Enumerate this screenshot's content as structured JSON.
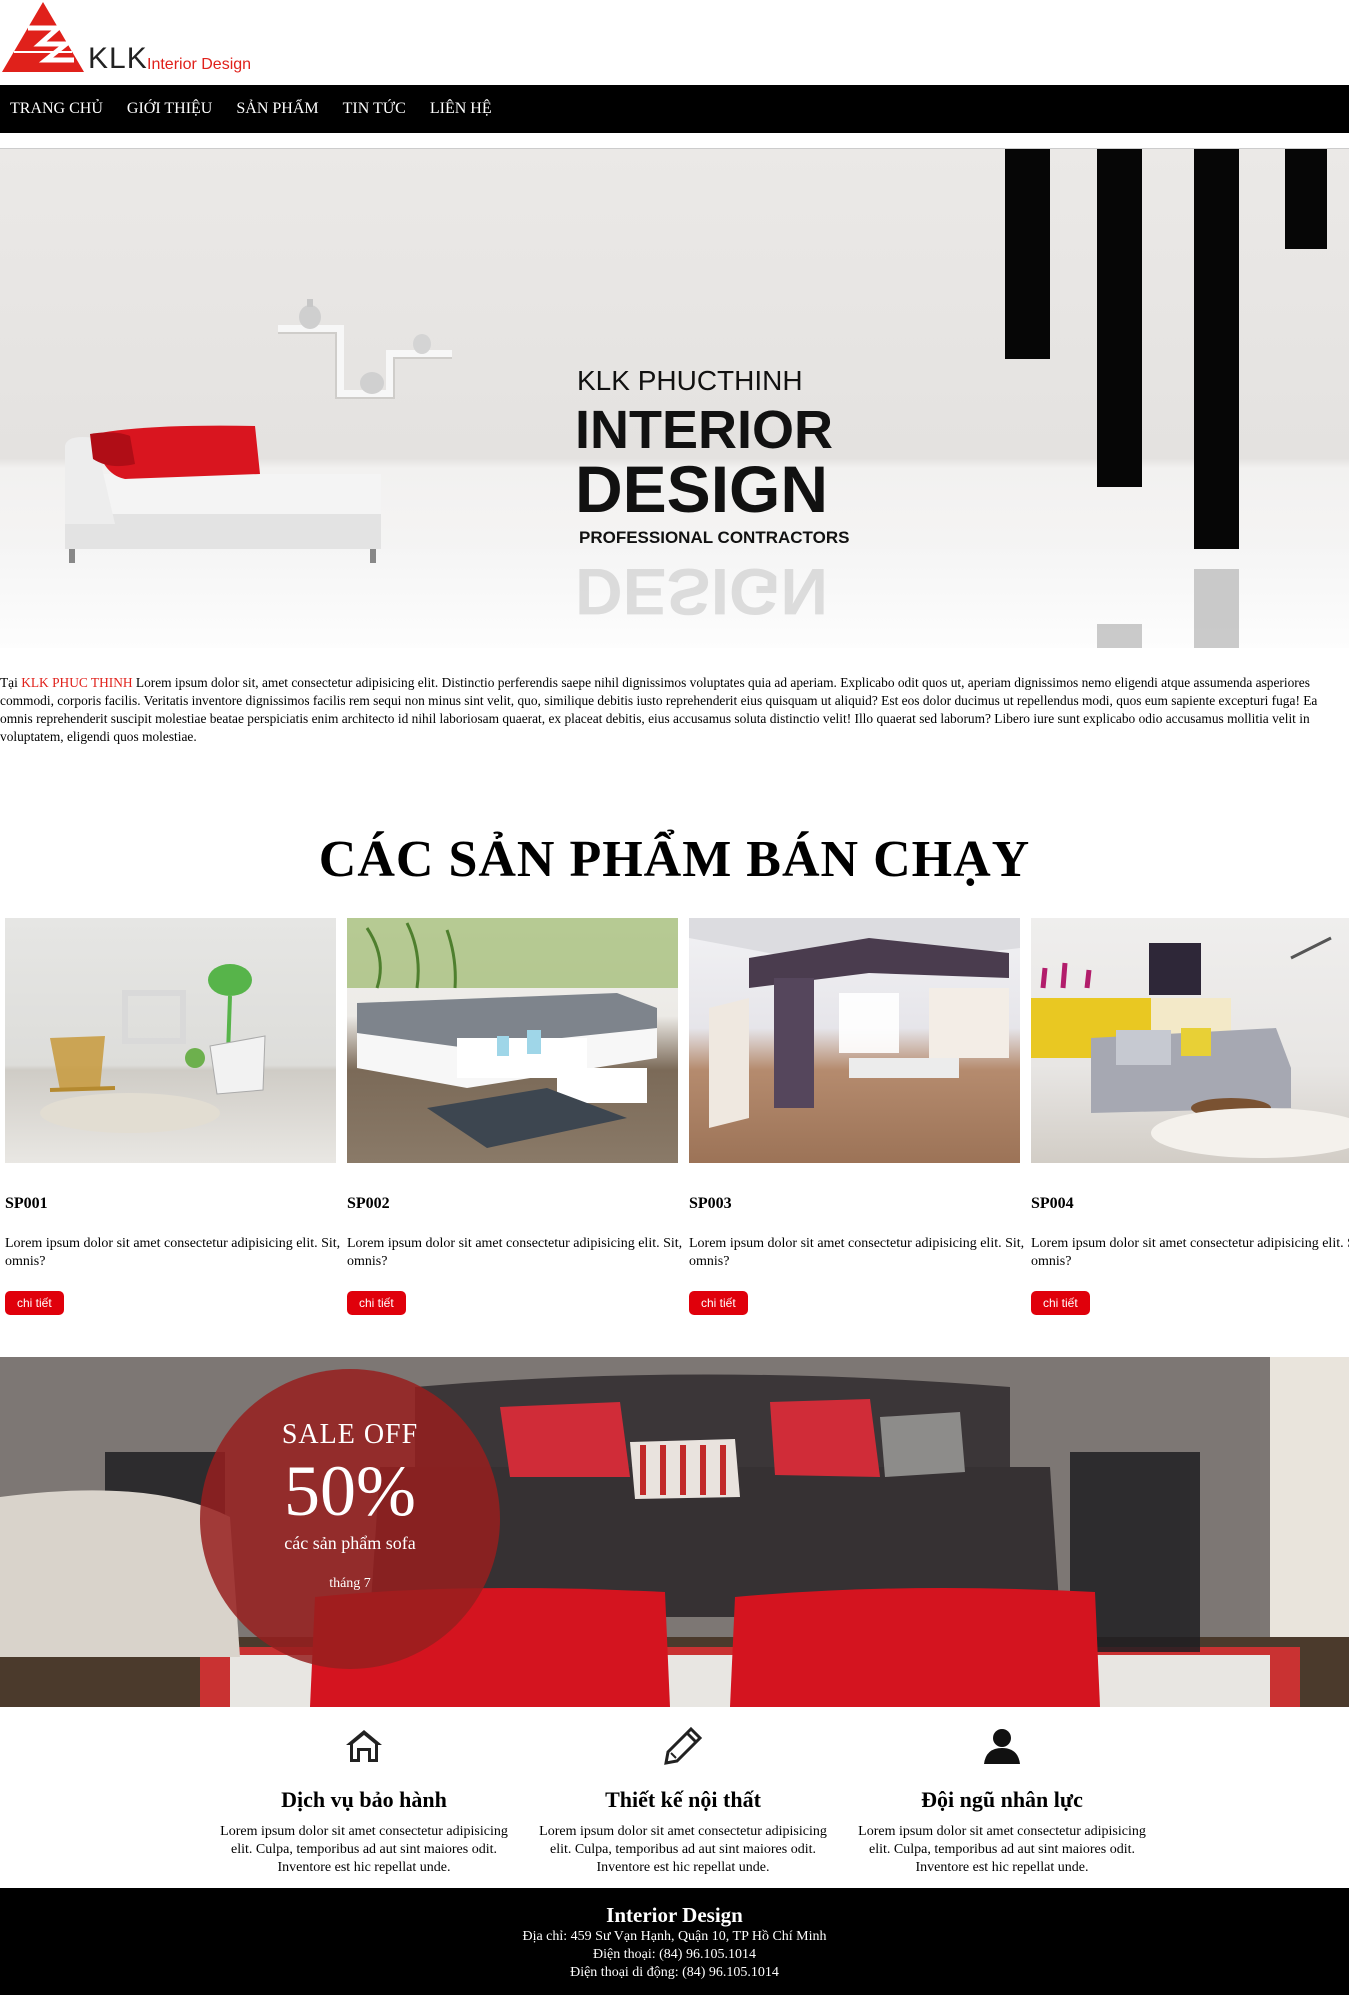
{
  "logo": {
    "brand": "KLK",
    "tagline": "Interior Design"
  },
  "nav": {
    "items": [
      "TRANG CHỦ",
      "GIỚI THIỆU",
      "SẢN PHẨM",
      "TIN TỨC",
      "LIÊN HỆ"
    ]
  },
  "hero": {
    "line1": "KLK PHUCTHINH",
    "line2": "INTERIOR",
    "line3": "DESIGN",
    "line4": "PROFESSIONAL CONTRACTORS",
    "reflection": "DESIGN"
  },
  "intro": {
    "prefix": "Tại ",
    "brand": "KLK PHUC THINH",
    "body": " Lorem ipsum dolor sit, amet consectetur adipisicing elit. Distinctio perferendis saepe nihil dignissimos voluptates quia ad aperiam. Explicabo odit quos ut, aperiam dignissimos nemo eligendi atque assumenda asperiores commodi, corporis facilis. Veritatis inventore dignissimos facilis rem sequi non minus sint velit, quo, similique debitis iusto reprehenderit eius quisquam ut aliquid? Est eos dolor ducimus ut repellendus modi, quos eum sapiente excepturi fuga! Ea omnis reprehenderit suscipit molestiae beatae perspiciatis enim architecto id nihil laboriosam quaerat, ex placeat debitis, eius accusamus soluta distinctio velit! Illo quaerat sed laborum? Libero iure sunt explicabo odio accusamus mollitia velit in voluptatem, eligendi quos molestiae."
  },
  "products_section": {
    "title": "CÁC SẢN PHẨM BÁN CHẠY"
  },
  "products": [
    {
      "code": "SP001",
      "desc": "Lorem ipsum dolor sit amet consectetur adipisicing elit. Sit, omnis?",
      "button": "chi tiết"
    },
    {
      "code": "SP002",
      "desc": "Lorem ipsum dolor sit amet consectetur adipisicing elit. Sit, omnis?",
      "button": "chi tiết"
    },
    {
      "code": "SP003",
      "desc": "Lorem ipsum dolor sit amet consectetur adipisicing elit. Sit, omnis?",
      "button": "chi tiết"
    },
    {
      "code": "SP004",
      "desc": "Lorem ipsum dolor sit amet consectetur adipisicing elit. Sit, omnis?",
      "button": "chi tiết"
    }
  ],
  "sale": {
    "label": "SALE OFF",
    "percent": "50%",
    "subtitle": "các sản phẩm sofa",
    "month": "tháng 7"
  },
  "services": [
    {
      "icon": "home-icon",
      "title": "Dịch vụ bảo hành",
      "desc": "Lorem ipsum dolor sit amet consectetur adipisicing elit. Culpa, temporibus ad aut sint maiores odit. Inventore est hic repellat unde."
    },
    {
      "icon": "pencil-icon",
      "title": "Thiết kế nội thất",
      "desc": "Lorem ipsum dolor sit amet consectetur adipisicing elit. Culpa, temporibus ad aut sint maiores odit. Inventore est hic repellat unde."
    },
    {
      "icon": "user-icon",
      "title": "Đội ngũ nhân lực",
      "desc": "Lorem ipsum dolor sit amet consectetur adipisicing elit. Culpa, temporibus ad aut sint maiores odit. Inventore est hic repellat unde."
    }
  ],
  "footer": {
    "title": "Interior Design",
    "address": "Địa chỉ: 459 Sư Vạn Hạnh, Quận 10, TP Hồ Chí Minh",
    "phone": "Điện thoại: (84) 96.105.1014",
    "mobile": "Điện thoại di động: (84) 96.105.1014"
  },
  "colors": {
    "accent": "#e0211b",
    "button": "#e0000b",
    "nav_bg": "#000000",
    "sale_circle": "#961e1e"
  }
}
